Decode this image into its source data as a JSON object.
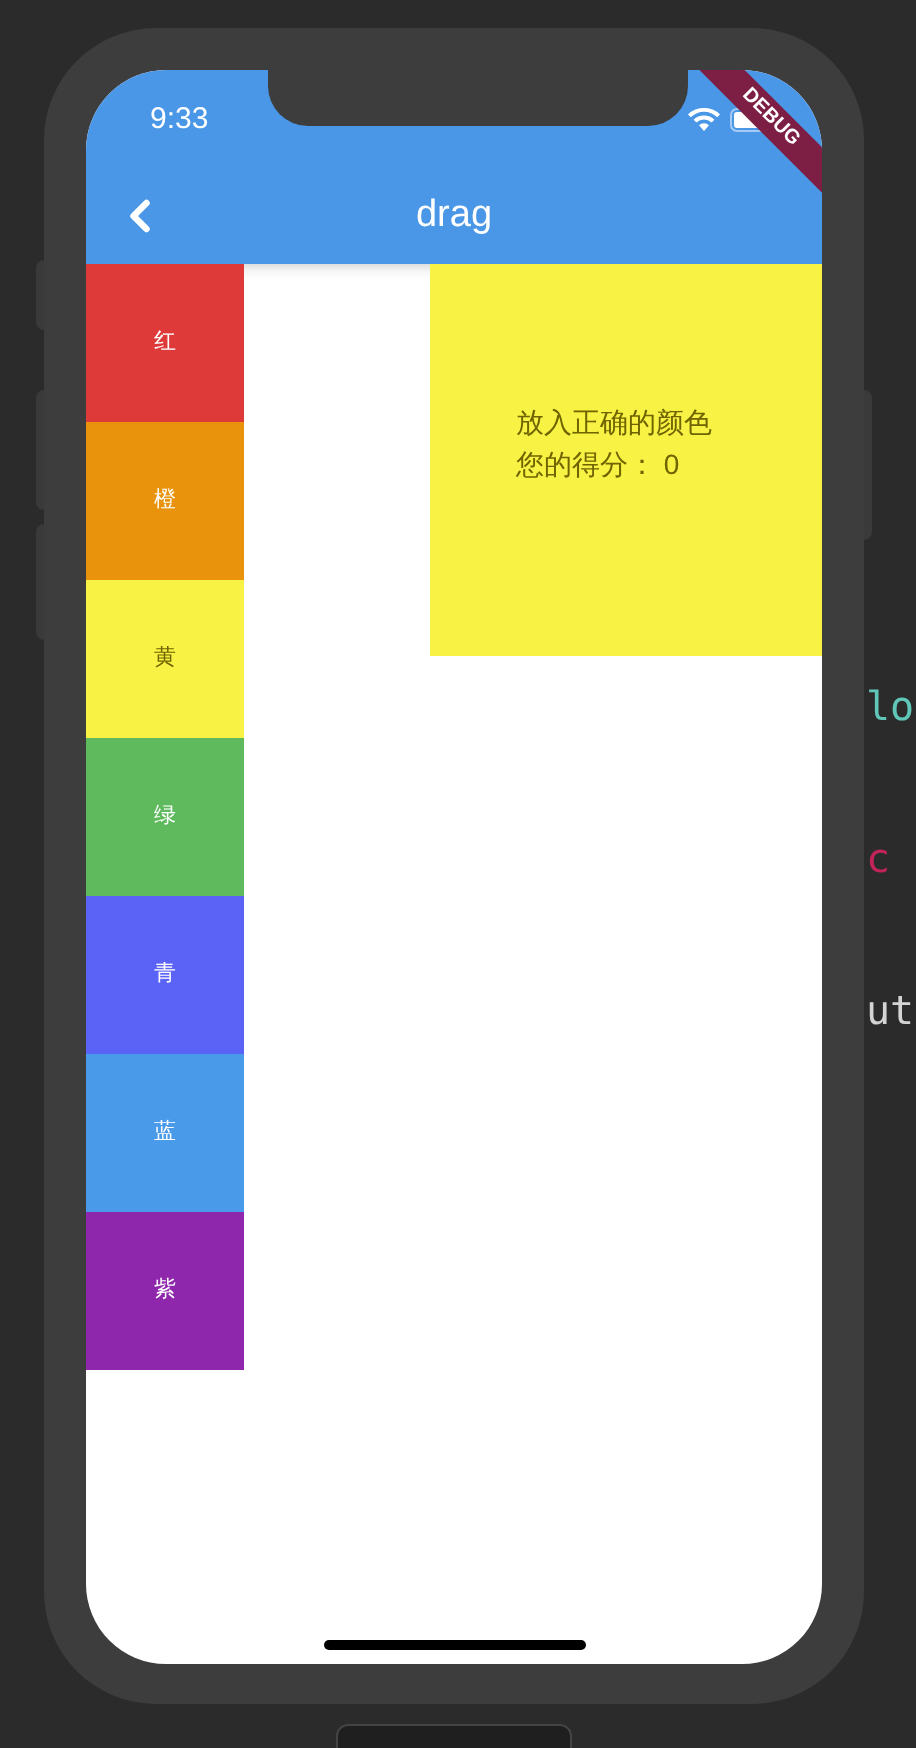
{
  "status_bar": {
    "time": "9:33"
  },
  "debug_banner": "DEBUG",
  "app_bar": {
    "title": "drag"
  },
  "color_blocks": [
    {
      "label": "红",
      "color": "#de3a3a"
    },
    {
      "label": "橙",
      "color": "#e8930b"
    },
    {
      "label": "黄",
      "color": "#f8f244"
    },
    {
      "label": "绿",
      "color": "#5fba5d"
    },
    {
      "label": "青",
      "color": "#5b63f7"
    },
    {
      "label": "蓝",
      "color": "#4a9aea"
    },
    {
      "label": "紫",
      "color": "#8f27ad"
    }
  ],
  "drop_target": {
    "color": "#f8f244",
    "lines": [
      "放入正确的颜色",
      "您的得分： 0"
    ]
  },
  "code_fragments": [
    {
      "text": "lo",
      "color": "#5fc6b8"
    },
    {
      "text": "c",
      "color": "#c2245a"
    },
    {
      "text": "ut",
      "color": "#d4d4d4"
    }
  ]
}
